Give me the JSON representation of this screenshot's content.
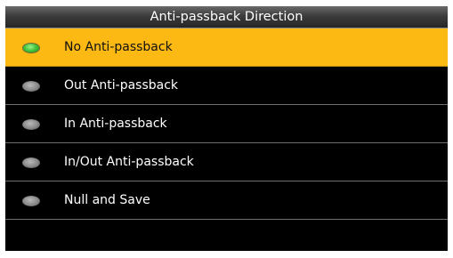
{
  "header": {
    "title": "Anti-passback Direction"
  },
  "options": [
    {
      "label": "No Anti-passback",
      "selected": true,
      "icon": "radio-selected-icon"
    },
    {
      "label": "Out Anti-passback",
      "selected": false,
      "icon": "radio-unselected-icon"
    },
    {
      "label": "In Anti-passback",
      "selected": false,
      "icon": "radio-unselected-icon"
    },
    {
      "label": "In/Out Anti-passback",
      "selected": false,
      "icon": "radio-unselected-icon"
    },
    {
      "label": "Null and Save",
      "selected": false,
      "icon": "radio-unselected-icon"
    }
  ],
  "colors": {
    "highlight": "#fdb913",
    "background": "#000000",
    "radio_on": "#3fbf36",
    "radio_off": "#888888"
  }
}
